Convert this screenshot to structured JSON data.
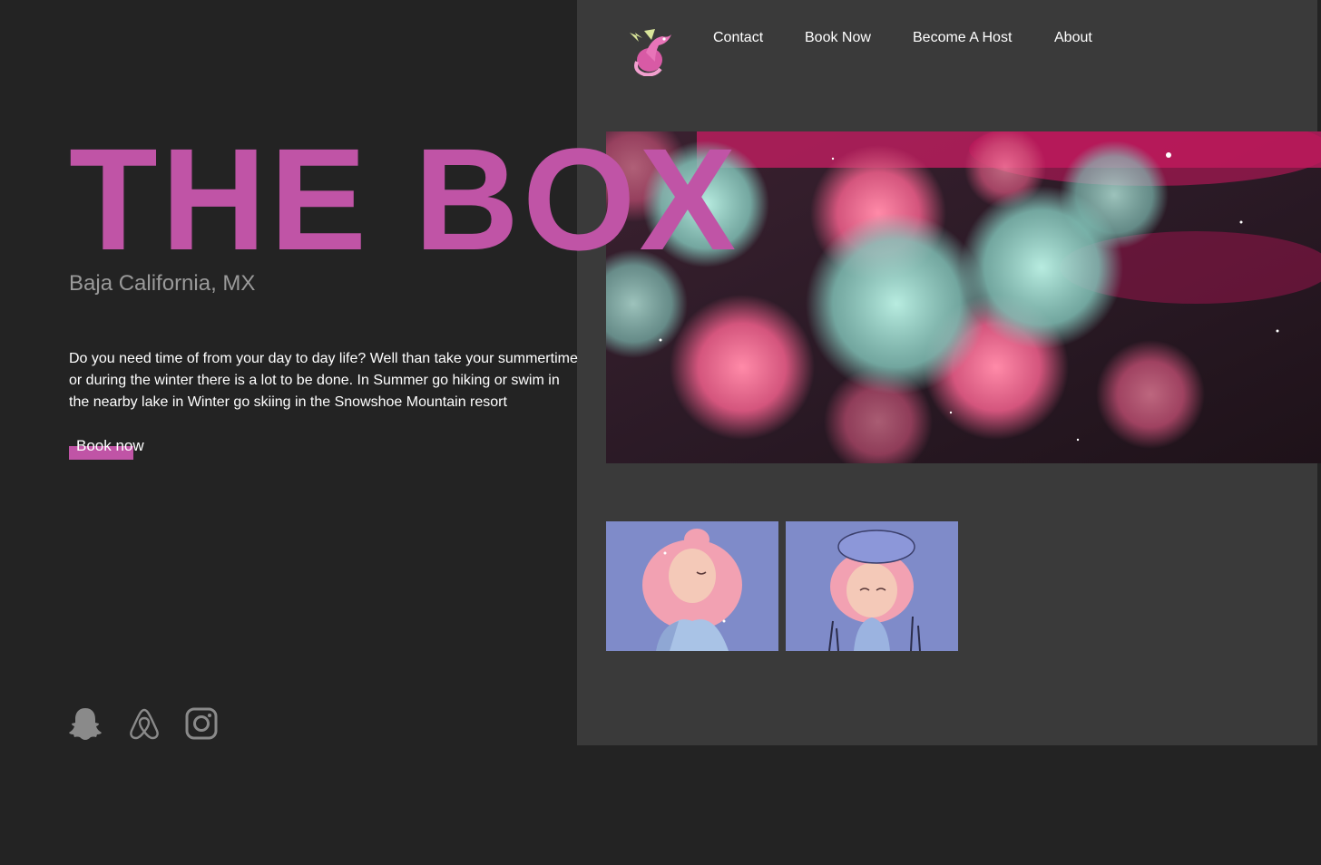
{
  "brand": {
    "logo_icon": "dragon-logo-icon",
    "accent": "#c054a6"
  },
  "nav": {
    "items": [
      {
        "label": "Contact"
      },
      {
        "label": "Book Now"
      },
      {
        "label": "Become A Host"
      },
      {
        "label": "About"
      }
    ]
  },
  "hero": {
    "title": "THE BOX",
    "location": "Baja California, MX",
    "description": "Do you need time of from your day to day life? Well than take your summertime or during the winter there is a lot to be done. In Summer go hiking or swim in the nearby lake in Winter go skiing in the Snowshoe Mountain resort",
    "cta_label": "Book now"
  },
  "gallery": {
    "main_image": "pink-roses-galaxy-image",
    "thumbnails": [
      "pink-hair-girl-illustration",
      "beret-girl-illustration"
    ]
  },
  "socials": [
    {
      "icon": "snapchat-icon"
    },
    {
      "icon": "airbnb-icon"
    },
    {
      "icon": "instagram-icon"
    }
  ],
  "colors": {
    "background": "#232323",
    "panel": "#3a3a3a",
    "thumb_bg": "#7f8bc9"
  }
}
